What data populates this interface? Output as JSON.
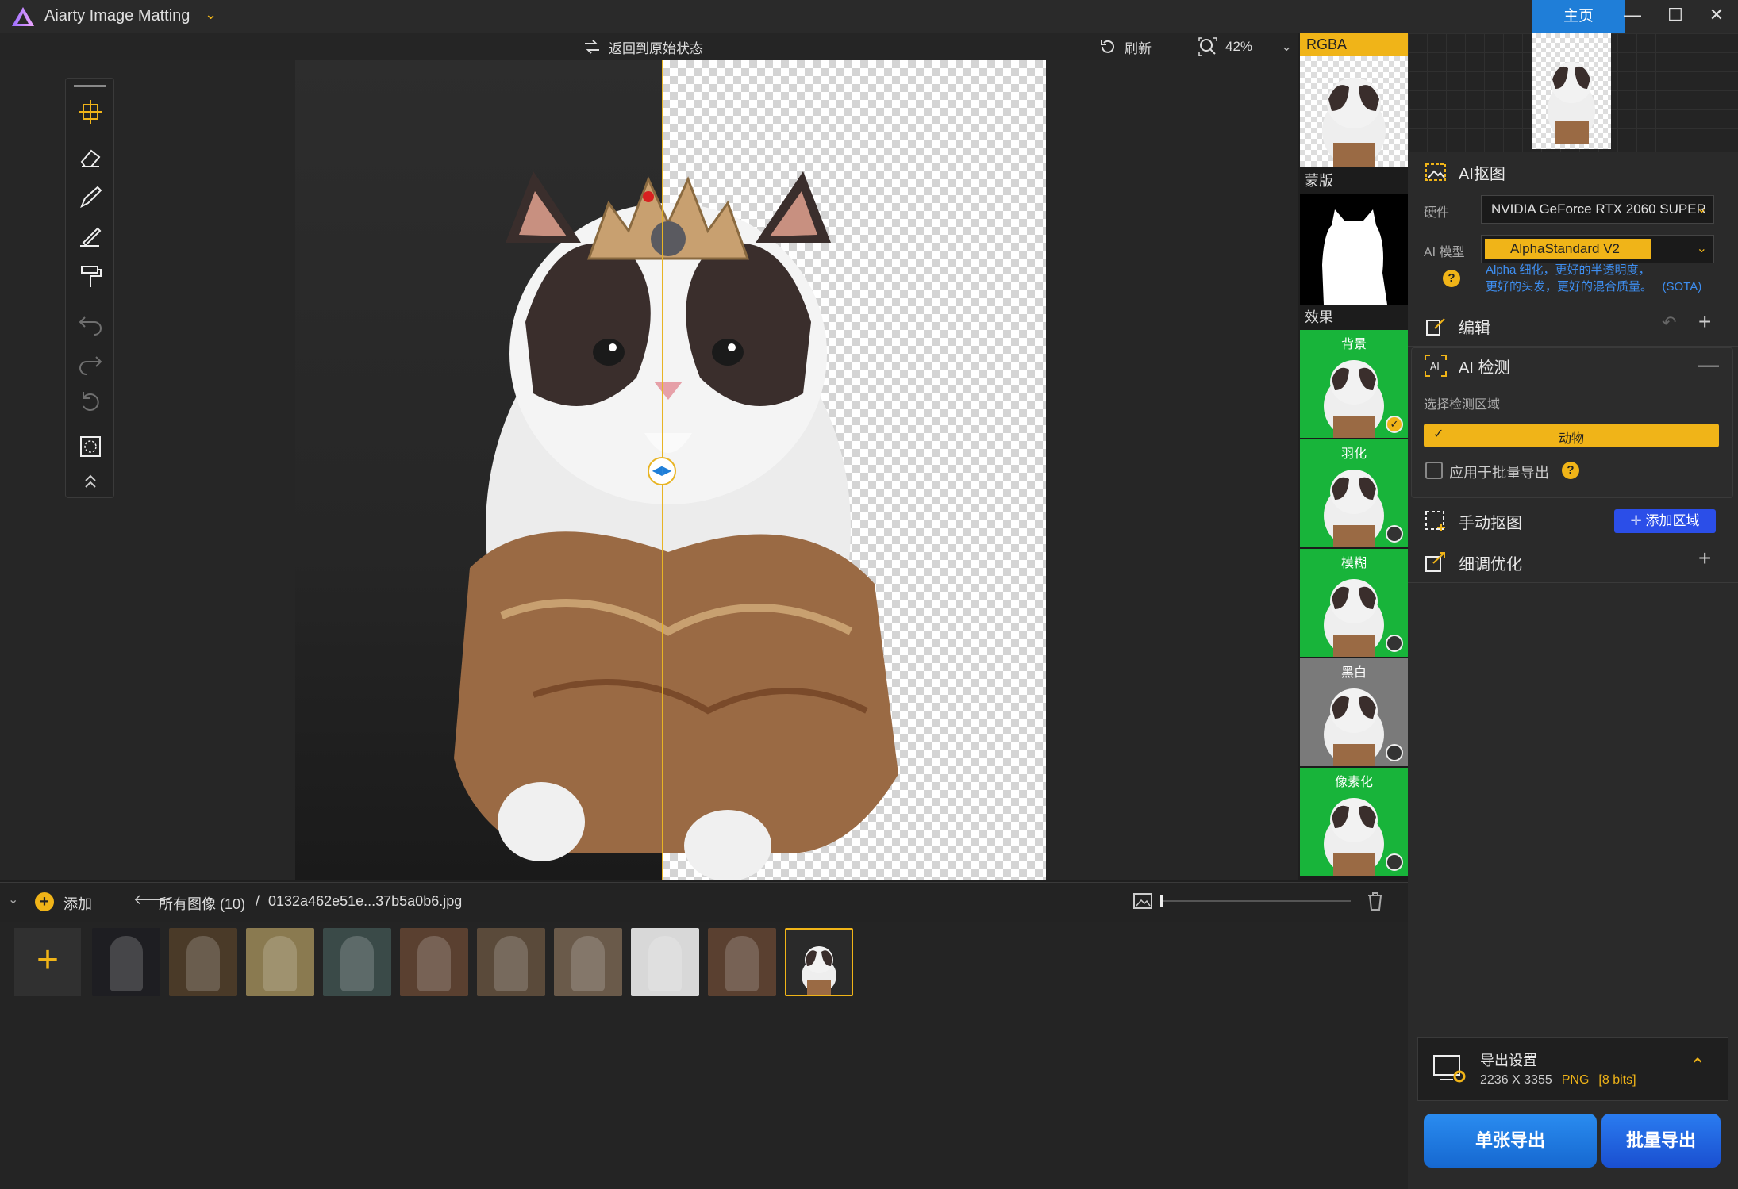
{
  "app": {
    "title": "Aiarty Image Matting",
    "home_tab": "主页"
  },
  "canvas_toolbar": {
    "reset_label": "返回到原始状态",
    "refresh_label": "刷新",
    "zoom_label": "42%"
  },
  "preview_strip": {
    "rgba_label": "RGBA",
    "mask_label": "蒙版",
    "effects_label": "效果",
    "effects": [
      {
        "label": "背景",
        "bg": "#18b43a",
        "selected": true
      },
      {
        "label": "羽化",
        "bg": "#18b43a",
        "selected": false
      },
      {
        "label": "模糊",
        "bg": "#18b43a",
        "selected": false
      },
      {
        "label": "黑白",
        "bg": "#7a7a7a",
        "selected": false
      },
      {
        "label": "像素化",
        "bg": "#18b43a",
        "selected": false
      }
    ],
    "check_mark": "✓"
  },
  "panel": {
    "ai_matting": {
      "title": "AI抠图",
      "hardware_label": "硬件",
      "hardware_value": "NVIDIA GeForce RTX 2060 SUPER",
      "model_label": "AI 模型",
      "model_value": "AlphaStandard  V2",
      "model_desc_line1": "Alpha 细化，更好的半透明度，",
      "model_desc_line2": "更好的头发，更好的混合质量。",
      "model_desc_tag": "(SOTA)"
    },
    "edit": {
      "title": "编辑"
    },
    "ai_detect": {
      "title": "AI 检测",
      "region_label": "选择检测区域",
      "region_value": "动物",
      "batch_label": "应用于批量导出"
    },
    "manual": {
      "title": "手动抠图",
      "add_region_label": "添加区域"
    },
    "refine": {
      "title": "细调优化"
    },
    "export": {
      "title": "导出设置",
      "size": "2236 X 3355",
      "format": "PNG",
      "bits": "[8 bits]",
      "single_label": "单张导出",
      "batch_label": "批量导出"
    }
  },
  "filmstrip": {
    "add_label": "添加",
    "all_images_label": "所有图像 (10)",
    "separator": "/",
    "current_file": "0132a462e51e...37b5a0b6.jpg",
    "add_plus": "+",
    "thumbs": [
      {
        "name": "jellyfish",
        "color": "#1e1e22"
      },
      {
        "name": "feathers",
        "color": "#4a3a28"
      },
      {
        "name": "bicycle",
        "color": "#8a7a50"
      },
      {
        "name": "woman-red-dress",
        "color": "#3a4a48"
      },
      {
        "name": "woman-flowers",
        "color": "#5a4030"
      },
      {
        "name": "woman-lace",
        "color": "#5a4a3a"
      },
      {
        "name": "woman-roses",
        "color": "#6a5a4a"
      },
      {
        "name": "woman-black",
        "color": "#d8d8d8"
      },
      {
        "name": "cat-fireplace",
        "color": "#5a4030"
      },
      {
        "name": "cat-crown",
        "color": "#2a2a2a"
      }
    ]
  },
  "colors": {
    "accent": "#f0b418",
    "blue": "#1f7ed8",
    "green": "#18b43a"
  }
}
